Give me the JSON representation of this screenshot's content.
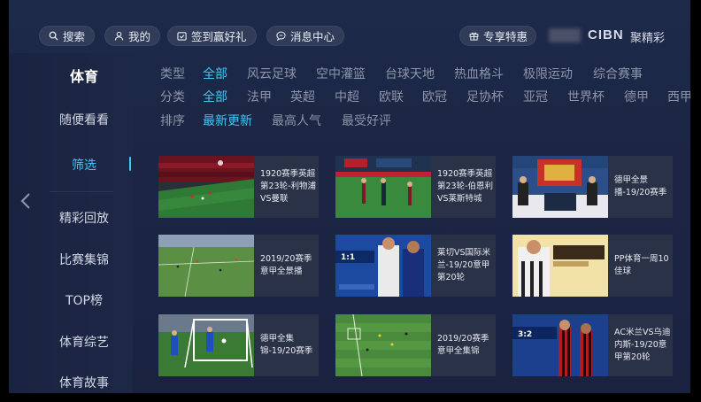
{
  "topbar": {
    "search_label": "搜索",
    "mine_label": "我的",
    "checkin_label": "签到赢好礼",
    "messages_label": "消息中心",
    "vip_label": "专享特惠",
    "logo_text": "CIBN",
    "brand_text": "聚精彩"
  },
  "sidebar": {
    "title": "体育",
    "items": [
      {
        "label": "随便看看"
      },
      {
        "label": "筛选"
      },
      {
        "label": "精彩回放"
      },
      {
        "label": "比赛集锦"
      },
      {
        "label": "TOP榜"
      },
      {
        "label": "体育综艺"
      },
      {
        "label": "体育故事"
      }
    ]
  },
  "filters": {
    "type": {
      "label": "类型",
      "options": [
        "全部",
        "风云足球",
        "空中灌篮",
        "台球天地",
        "热血格斗",
        "极限运动",
        "综合赛事"
      ],
      "selected": "全部"
    },
    "category": {
      "label": "分类",
      "options": [
        "全部",
        "法甲",
        "英超",
        "中超",
        "欧联",
        "欧冠",
        "足协杯",
        "亚冠",
        "世界杯",
        "德甲",
        "西甲"
      ],
      "selected": "全部"
    },
    "sort": {
      "label": "排序",
      "options": [
        "最新更新",
        "最高人气",
        "最受好评"
      ],
      "selected": "最新更新"
    }
  },
  "videos": [
    {
      "title_lines": [
        "1920赛季英超",
        "第23轮-利物浦",
        "VS曼联"
      ],
      "thumb": "soccer-stadium-crowd"
    },
    {
      "title_lines": [
        "1920赛季英超",
        "第23轮-伯恩利",
        "VS莱斯特城"
      ],
      "thumb": "soccer-match-players"
    },
    {
      "title_lines": [
        "德甲全景",
        "播-19/20赛季"
      ],
      "thumb": "tv-studio-presenters"
    },
    {
      "title_lines": [
        "2019/20赛季",
        "意甲全景播"
      ],
      "thumb": "soccer-aerial-field"
    },
    {
      "title_lines": [
        "莱切VS国际米",
        "兰-19/20意甲",
        "第20轮"
      ],
      "thumb": "inter-milan-score"
    },
    {
      "title_lines": [
        "PP体育一周10",
        "佳球"
      ],
      "thumb": "pp-top10-cover"
    },
    {
      "title_lines": [
        "德甲全集",
        "锦-19/20赛季"
      ],
      "thumb": "goal-net-action"
    },
    {
      "title_lines": [
        "2019/20赛季",
        "意甲全集锦"
      ],
      "thumb": "soccer-green-pitch"
    },
    {
      "title_lines": [
        "AC米兰VS乌迪",
        "内斯-19/20意",
        "甲第20轮"
      ],
      "thumb": "ac-milan-score"
    }
  ],
  "colors": {
    "accent": "#3ec8f2",
    "tile_bg": "#2a3247"
  }
}
